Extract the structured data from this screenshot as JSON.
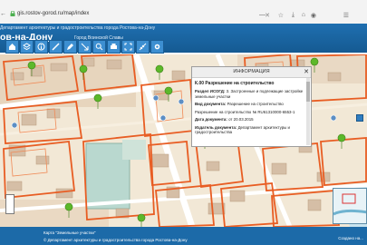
{
  "browser": {
    "url": "gis.rostov-gorod.ru/map/index",
    "back_arrow": "←",
    "minimize": "—",
    "close": "✕"
  },
  "header": {
    "department": "Департамент архитектуры и градостроительства города Ростова-на-Дону",
    "city_title": "ов-на-Дону",
    "subtitle": "Город Воинской Славы"
  },
  "toolbar": {
    "icons": [
      "home-icon",
      "layers-icon",
      "info-icon",
      "ruler-icon",
      "edit-icon",
      "arrow-icon",
      "search-icon",
      "print-icon",
      "expand-icon",
      "measure-icon",
      "settings-icon"
    ]
  },
  "popup": {
    "title": "ИНФОРМАЦИЯ",
    "close": "✕",
    "heading": "К.00 Разрешение на строительство",
    "section_label": "Раздел ИСОГД:",
    "section_value": "3. Застроенные и подлежащие застройке земельные участки",
    "doc_type_label": "Вид документа:",
    "doc_type_value": "Разрешение на строительство",
    "permit": "Разрешение на строительство № RU61310000-6553-1",
    "date_label": "Дата документа:",
    "date_value": "от 20.03.2015",
    "issuer_label": "Издатель документа:",
    "issuer_value": "Департамент архитектуры и градостроительства"
  },
  "footer": {
    "map_name": "Карта \"Земельные участки\"",
    "copyright": "© Департамент архитектуры и градостроительства города Ростова-на-Дону",
    "link": "Создано на..."
  },
  "colors": {
    "header_blue": "#1a64a5",
    "map_bg": "#f2e8d6",
    "parcel_orange": "#e85d23",
    "marker_green": "#5cb82a",
    "building": "#d8c3ad",
    "school": "#b9d8cf"
  }
}
